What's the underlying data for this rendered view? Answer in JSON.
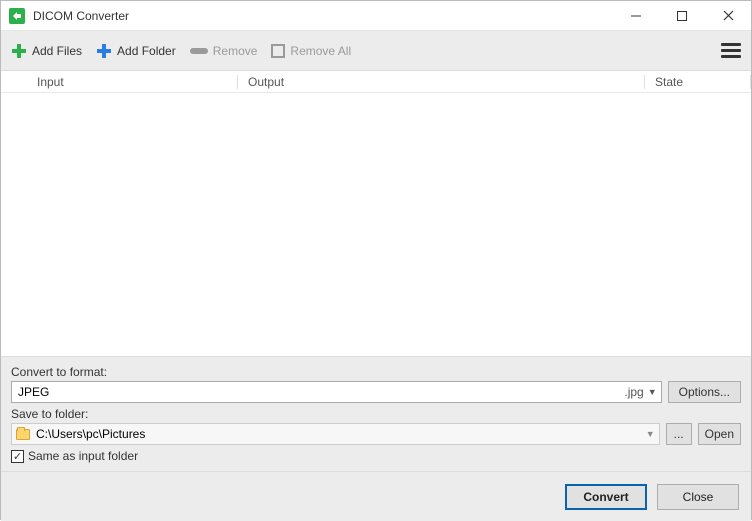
{
  "window": {
    "title": "DICOM Converter"
  },
  "toolbar": {
    "add_files": "Add Files",
    "add_folder": "Add Folder",
    "remove": "Remove",
    "remove_all": "Remove All"
  },
  "columns": {
    "input": "Input",
    "output": "Output",
    "state": "State"
  },
  "convert": {
    "label": "Convert to format:",
    "format_name": "JPEG",
    "format_ext": ".jpg",
    "options_btn": "Options..."
  },
  "save": {
    "label": "Save to folder:",
    "path": "C:\\Users\\pc\\Pictures",
    "browse_btn": "...",
    "open_btn": "Open",
    "same_as_input": "Same as input folder",
    "same_as_input_checked": true
  },
  "footer": {
    "convert": "Convert",
    "close": "Close"
  }
}
